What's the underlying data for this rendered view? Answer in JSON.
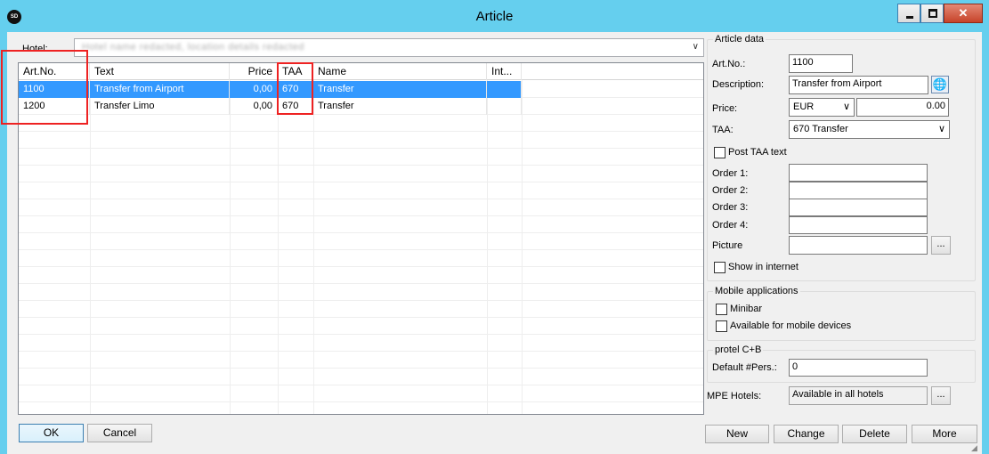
{
  "window": {
    "title": "Article",
    "app_logo": "SD",
    "close_glyph": "✕"
  },
  "hotel": {
    "label": "Hotel:",
    "value": "Hotel name redacted, location details redacted",
    "caret": "∨"
  },
  "grid": {
    "columns": [
      "Art.No.",
      "Text",
      "Price",
      "TAA",
      "Name",
      "Int..."
    ],
    "rows": [
      {
        "art_no": "1100",
        "text": "Transfer from Airport",
        "price": "0,00",
        "taa": "670",
        "name": "Transfer",
        "selected": true
      },
      {
        "art_no": "1200",
        "text": "Transfer Limo",
        "price": "0,00",
        "taa": "670",
        "name": "Transfer",
        "selected": false
      }
    ]
  },
  "article_data": {
    "group_title": "Article data",
    "art_no_label": "Art.No.:",
    "art_no_value": "1100",
    "description_label": "Description:",
    "description_value": "Transfer from Airport",
    "price_label": "Price:",
    "currency": "EUR",
    "price_value": "0.00",
    "taa_label": "TAA:",
    "taa_value": "670 Transfer",
    "post_taa_label": "Post TAA text",
    "order1_label": "Order 1:",
    "order2_label": "Order 2:",
    "order3_label": "Order 3:",
    "order4_label": "Order 4:",
    "picture_label": "Picture",
    "browse_label": "...",
    "show_internet_label": "Show in internet"
  },
  "mobile": {
    "group_title": "Mobile applications",
    "minibar_label": "Minibar",
    "mobile_devices_label": "Available for mobile devices"
  },
  "protel": {
    "group_title": "protel C+B",
    "default_pers_label": "Default #Pers.:",
    "default_pers_value": "0"
  },
  "mpe": {
    "label": "MPE Hotels:",
    "value": "Available in all hotels",
    "browse_label": "..."
  },
  "buttons": {
    "ok": "OK",
    "cancel": "Cancel",
    "new": "New",
    "change": "Change",
    "delete": "Delete",
    "more": "More"
  },
  "colors": {
    "titlebar": "#65cfee",
    "selection": "#3399ff",
    "annotation": "#e22222"
  }
}
